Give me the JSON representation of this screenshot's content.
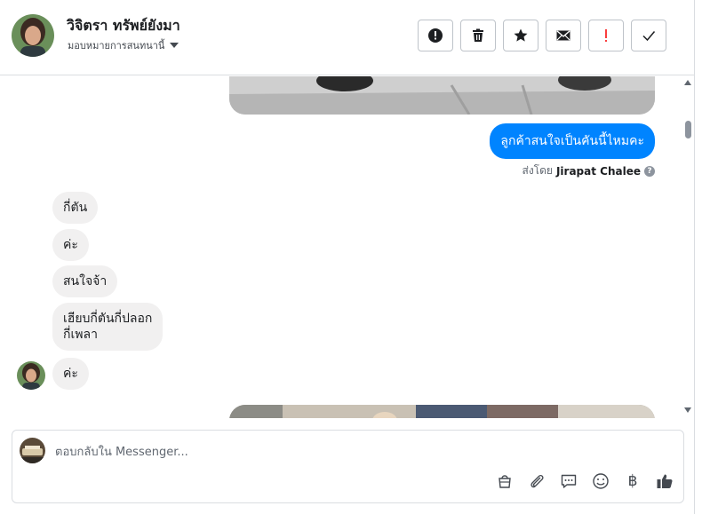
{
  "header": {
    "contact_name": "วิจิตรา ทรัพย์ยังมา",
    "assign_label": "มอบหมายการสนทนานี้",
    "actions": [
      {
        "icon": "alert-circle-icon",
        "label": "spam"
      },
      {
        "icon": "trash-icon",
        "label": "delete"
      },
      {
        "icon": "star-icon",
        "label": "star"
      },
      {
        "icon": "envelope-icon",
        "label": "mark-unread"
      },
      {
        "icon": "exclamation-icon",
        "label": "follow-up",
        "color": "#fa3e3e"
      },
      {
        "icon": "check-icon",
        "label": "done"
      }
    ]
  },
  "thread": {
    "outgoing": {
      "text": "ลูกค้าสนใจเป็นคันนี้ไหมคะ",
      "sent_by_prefix": "ส่งโดย",
      "sent_by_name": "Jirapat Chalee",
      "info_glyph": "?"
    },
    "incoming": [
      {
        "text": "กี่ตัน"
      },
      {
        "text": "ค่ะ"
      },
      {
        "text": "สนใจจ้า"
      },
      {
        "text": "เฮียบกี่ตันกี่ปลอก\nกี่เพลา"
      },
      {
        "text": "ค่ะ"
      }
    ]
  },
  "composer": {
    "placeholder": "ตอบกลับใน Messenger...",
    "tools": [
      "shopping-bag-icon",
      "paperclip-icon",
      "saved-reply-icon",
      "emoji-icon",
      "baht-icon",
      "thumbs-up-icon"
    ],
    "baht_glyph": "฿"
  },
  "colors": {
    "accent": "#0084ff",
    "incoming_bubble": "#f1f0f0",
    "border": "#dadde1"
  }
}
